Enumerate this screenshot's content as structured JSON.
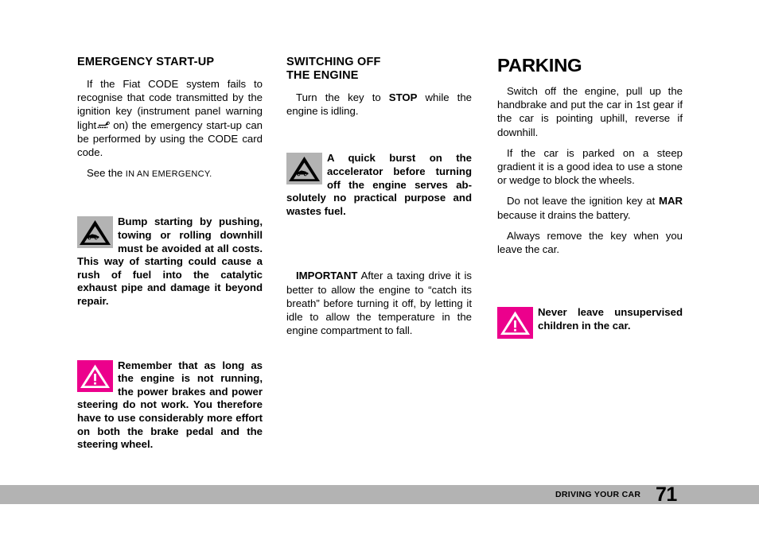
{
  "page": {
    "number": "71",
    "footer_section": "DRIVING YOUR CAR"
  },
  "column_1": {
    "heading": "EMERGENCY START-UP",
    "para_1_part_a": "If the Fiat CODE system fails to recognise that code transmitted by the ignition key (instrument panel warning light",
    "para_1_part_b": "on) the emergency start-up can be performed by using the CODE card code.",
    "para_2_lead": "See the",
    "para_2_smallcaps": "IN AN EMERGENCY.",
    "warning_1": {
      "icon": "gray-triangle-car-warning-icon",
      "bold_lead": "Bump starting by pushing, towing or rolling downhill must be avoided",
      "text": "at all costs. This way of starting could cause a rush of fuel into the catalytic exhaust pipe and damage it beyond repair."
    },
    "warning_2": {
      "icon": "pink-triangle-exclamation-warning-icon",
      "bold_lead": "Remember that as long as the engine is not running, the power brakes",
      "text": "and power steering do not work. You therefore have to use considerably more effort on both the brake pedal and the steering wheel."
    }
  },
  "column_2": {
    "heading": "SWITCHING OFF\nTHE ENGINE",
    "para_1_before": "Turn the key to",
    "para_1_bold": "STOP",
    "para_1_after": "while the engine is idling.",
    "warning_1": {
      "icon": "gray-triangle-car-warning-icon",
      "bold_lead": "A quick burst on the accelerator before turning off the engine serves ab-",
      "text": "solutely no practical purpose and wastes fuel."
    },
    "important": {
      "label": "IMPORTANT",
      "text": "After a taxing drive it is better to allow the engine to “catch its breath” before turning it off, by letting it idle to allow the temperature in the engine compartment to fall."
    }
  },
  "column_3": {
    "heading": "PARKING",
    "para_1": "Switch off the engine, pull up the handbrake and put the car in 1st gear if the car is pointing uphill, reverse if downhill.",
    "para_2": "If the car is parked on a steep gradient it is a good idea to use a stone or wedge to block the wheels.",
    "para_3_before": "Do not leave the ignition key at",
    "para_3_bold": "MAR",
    "para_3_after": "because it drains the battery.",
    "para_4": "Always remove the key when you leave the car.",
    "warning_1": {
      "icon": "pink-triangle-exclamation-warning-icon",
      "text": "Never leave unsupervised children in the car."
    }
  },
  "colors": {
    "warning_pink": "#ec008c",
    "warning_gray": "#b3b3b3",
    "footer_gray": "#b3b3b3",
    "text": "#000000"
  }
}
